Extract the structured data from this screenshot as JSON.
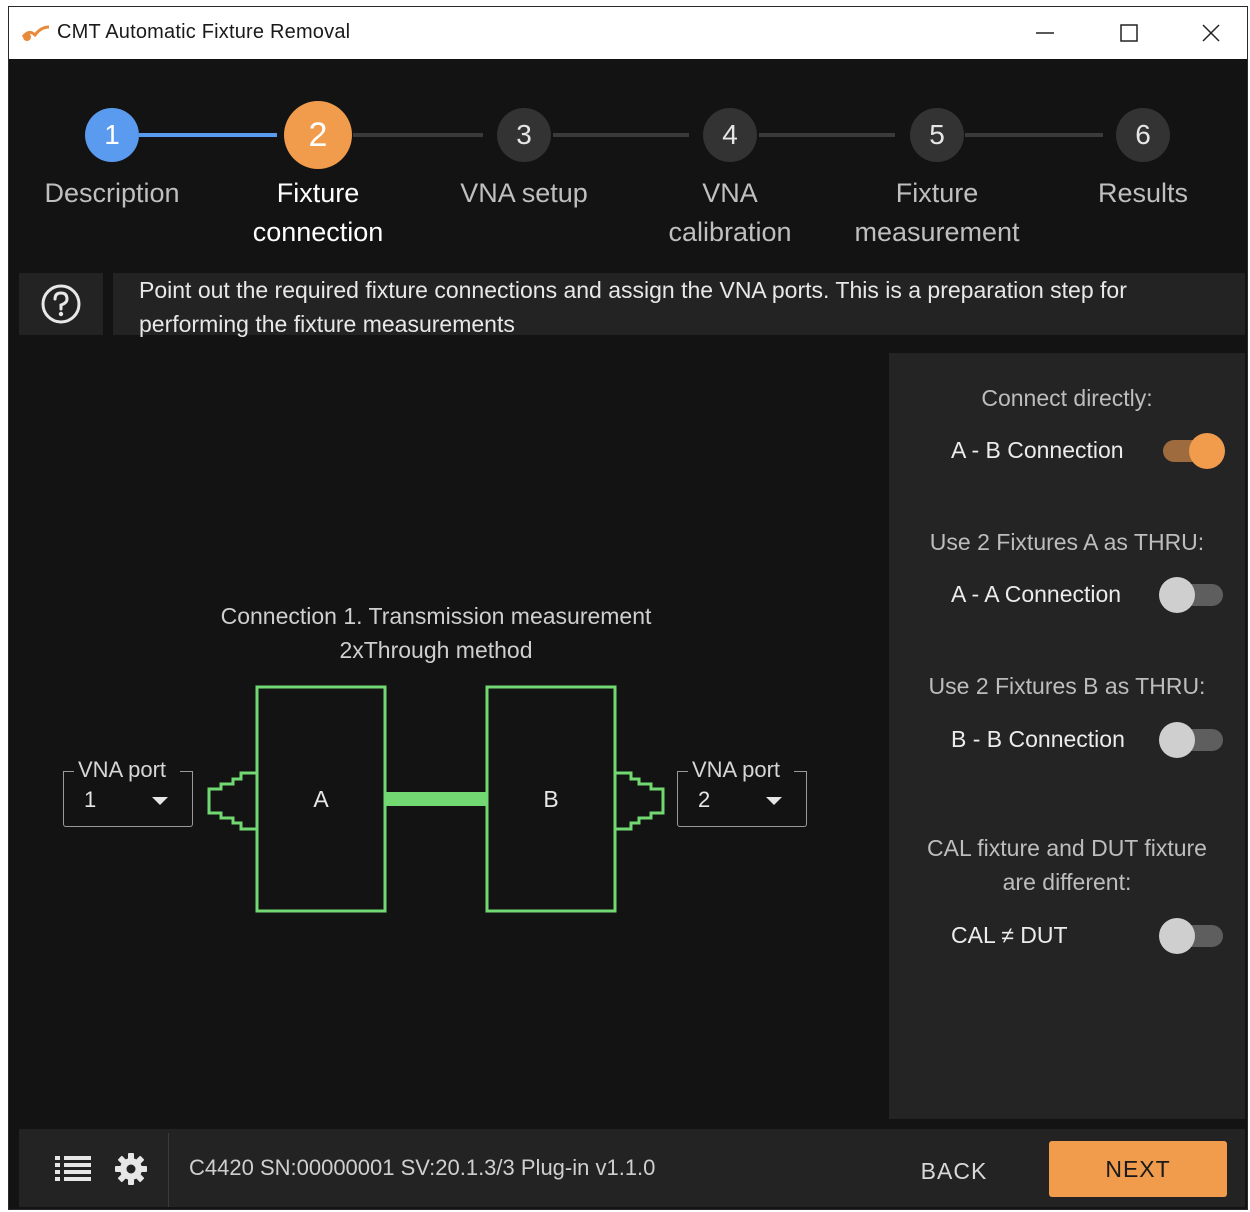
{
  "window": {
    "title": "CMT Automatic Fixture Removal",
    "app_icon": "fixture-app-icon",
    "controls": [
      "minimize-icon",
      "maximize-icon",
      "close-icon"
    ]
  },
  "stepper": {
    "steps": [
      {
        "number": "1",
        "line1": "Description",
        "line2": "",
        "state": "done"
      },
      {
        "number": "2",
        "line1": "Fixture",
        "line2": "connection",
        "state": "active"
      },
      {
        "number": "3",
        "line1": "VNA setup",
        "line2": "",
        "state": "pending"
      },
      {
        "number": "4",
        "line1": "VNA",
        "line2": "calibration",
        "state": "pending"
      },
      {
        "number": "5",
        "line1": "Fixture",
        "line2": "measurement",
        "state": "pending"
      },
      {
        "number": "6",
        "line1": "Results",
        "line2": "",
        "state": "pending"
      }
    ]
  },
  "help": {
    "icon": "help-circle-icon",
    "text": "Point out the required fixture connections and assign the VNA ports. This is a preparation step for performing the fixture measurements"
  },
  "diagram": {
    "title_line1": "Connection 1. Transmission measurement",
    "title_line2": "2xThrough method",
    "fixture_a": "A",
    "fixture_b": "B",
    "port_left": {
      "legend": "VNA port",
      "value": "1"
    },
    "port_right": {
      "legend": "VNA port",
      "value": "2"
    }
  },
  "options": {
    "connect_directly": {
      "heading": "Connect directly:",
      "label": "A - B Connection",
      "on": true
    },
    "a_thru": {
      "heading": "Use 2 Fixtures A as THRU:",
      "label": "A - A Connection",
      "on": false
    },
    "b_thru": {
      "heading": "Use 2 Fixtures B as THRU:",
      "label": "B - B Connection",
      "on": false
    },
    "cal_dut": {
      "heading_line1": "CAL fixture and DUT fixture",
      "heading_line2": "are different:",
      "label": "CAL ≠ DUT",
      "on": false
    }
  },
  "bottom": {
    "device_info": "C4420 SN:00000001 SV:20.1.3/3 Plug-in v1.1.0",
    "back_label": "BACK",
    "next_label": "NEXT"
  },
  "colors": {
    "done": "#5b9bef",
    "active": "#f19b4d",
    "fixture_outline": "#72d872",
    "background": "#131313"
  }
}
